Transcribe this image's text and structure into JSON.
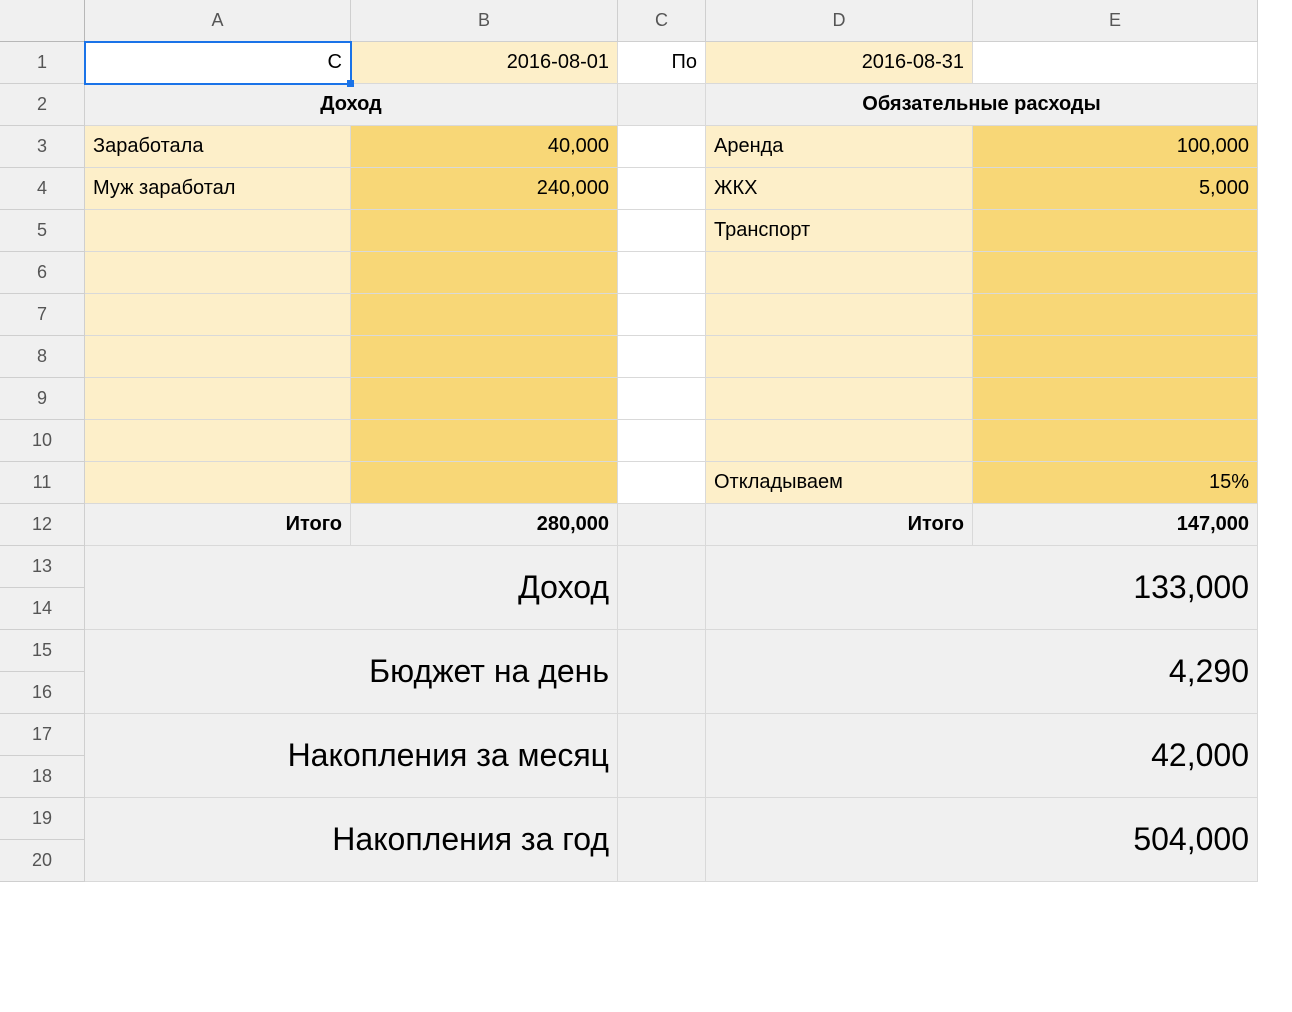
{
  "columns": [
    "A",
    "B",
    "C",
    "D",
    "E"
  ],
  "rows": [
    "1",
    "2",
    "3",
    "4",
    "5",
    "6",
    "7",
    "8",
    "9",
    "10",
    "11",
    "12",
    "13",
    "14",
    "15",
    "16",
    "17",
    "18",
    "19",
    "20"
  ],
  "row1": {
    "A": "С",
    "B": "2016-08-01",
    "C": "По",
    "D": "2016-08-31"
  },
  "headers": {
    "income": "Доход",
    "expenses": "Обязательные расходы"
  },
  "income": {
    "items": [
      {
        "label": "Заработала",
        "value": "40,000"
      },
      {
        "label": "Муж заработал",
        "value": "240,000"
      }
    ],
    "total_label": "Итого",
    "total_value": "280,000"
  },
  "expenses": {
    "items": [
      {
        "label": "Аренда",
        "value": "100,000"
      },
      {
        "label": "ЖКХ",
        "value": "5,000"
      },
      {
        "label": "Транспорт",
        "value": ""
      }
    ],
    "savings": {
      "label": "Откладываем",
      "value": "15%"
    },
    "total_label": "Итого",
    "total_value": "147,000"
  },
  "summary": [
    {
      "rows": [
        "13",
        "14"
      ],
      "label": "Доход",
      "value": "133,000"
    },
    {
      "rows": [
        "15",
        "16"
      ],
      "label": "Бюджет на день",
      "value": "4,290"
    },
    {
      "rows": [
        "17",
        "18"
      ],
      "label": "Накопления за месяц",
      "value": "42,000"
    },
    {
      "rows": [
        "19",
        "20"
      ],
      "label": "Накопления за год",
      "value": "504,000"
    }
  ]
}
